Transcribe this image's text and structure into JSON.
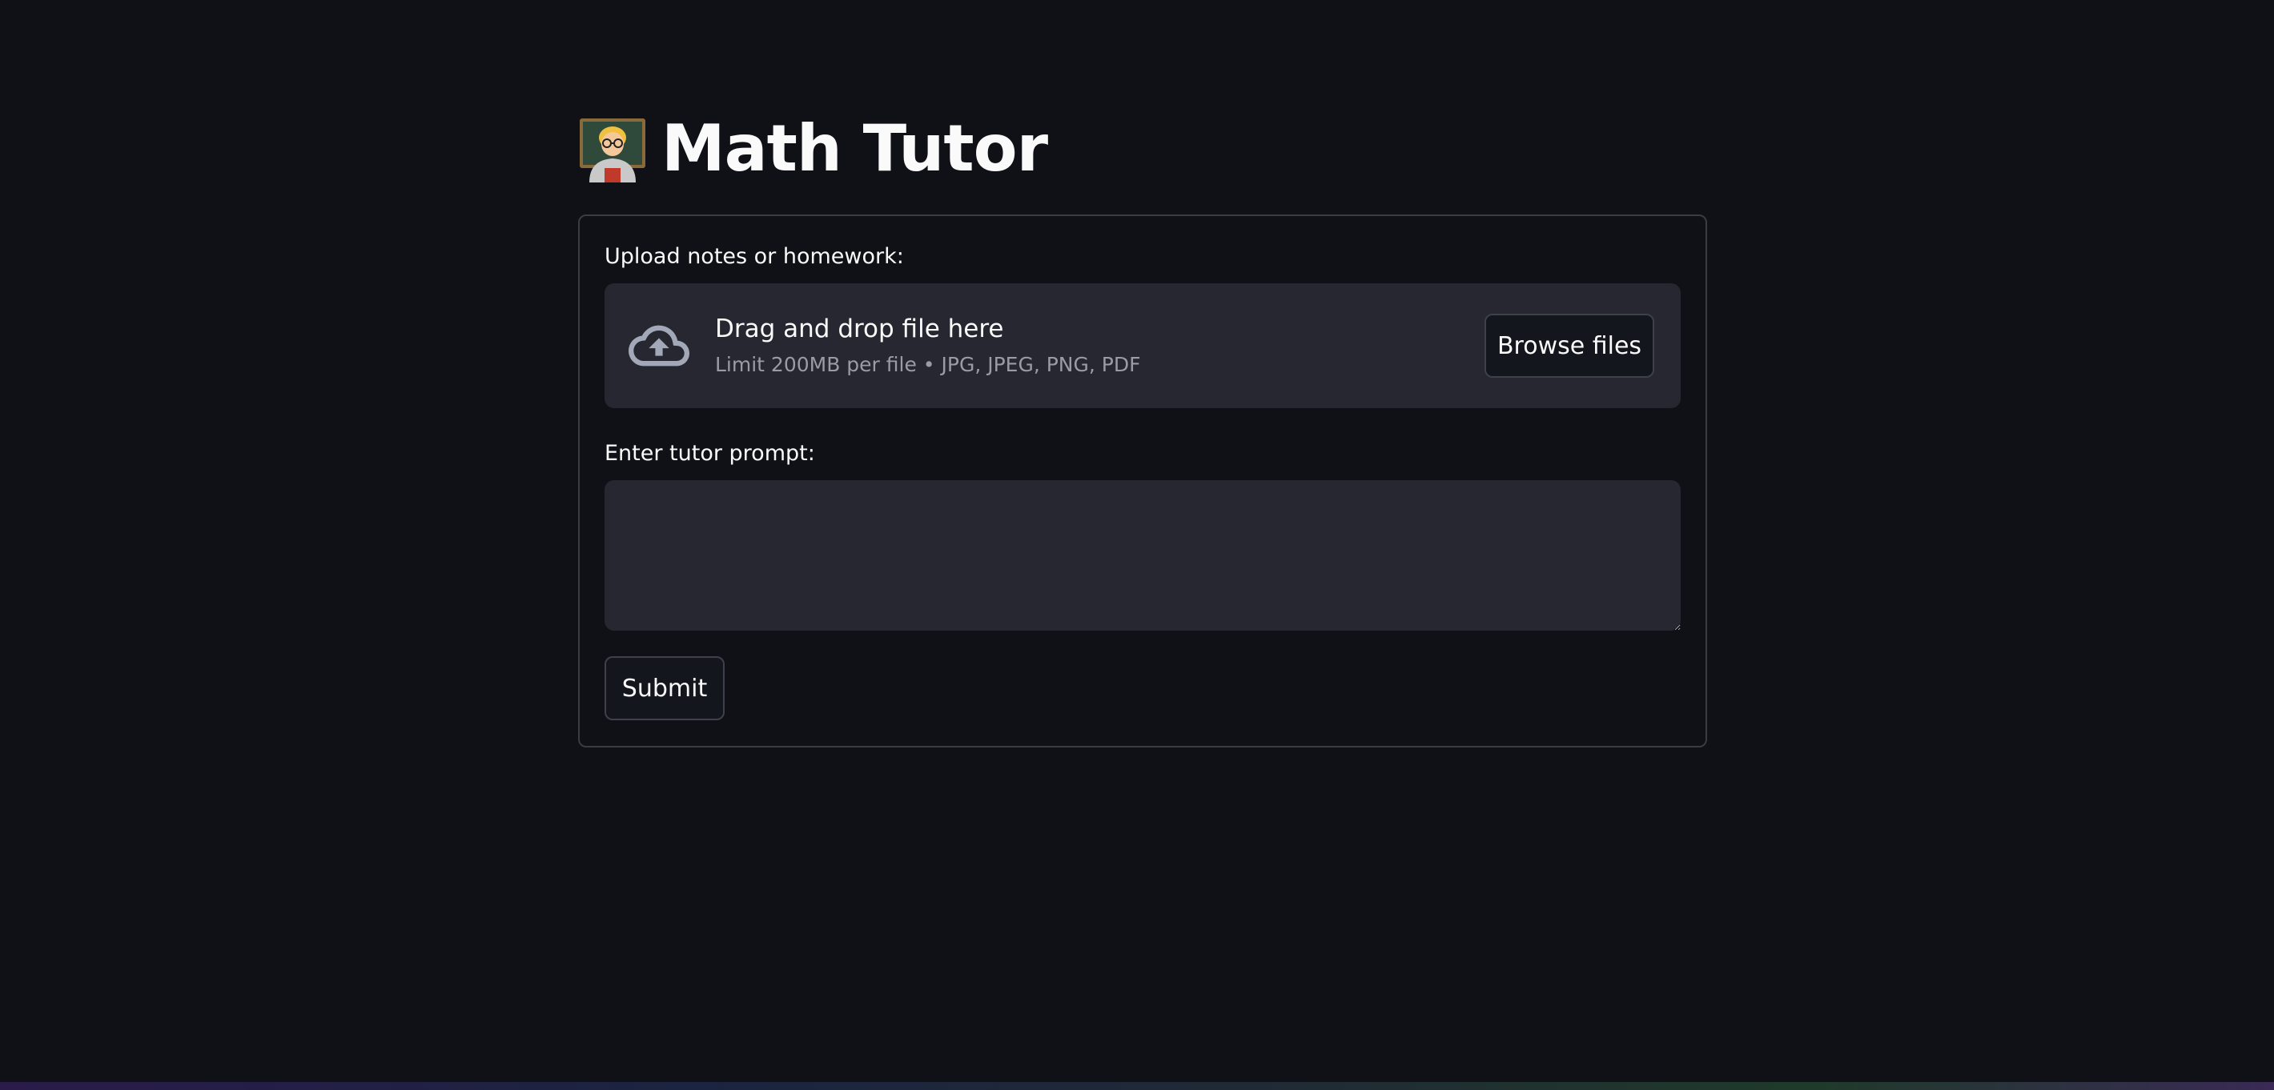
{
  "page": {
    "title": "Math Tutor",
    "title_icon": "teacher-emoji-icon"
  },
  "uploader": {
    "label": "Upload notes or homework:",
    "drop_title": "Drag and drop file here",
    "drop_subtitle": "Limit 200MB per file • JPG, JPEG, PNG, PDF",
    "browse_label": "Browse files",
    "icon": "cloud-upload-icon"
  },
  "prompt": {
    "label": "Enter tutor prompt:",
    "value": "",
    "placeholder": ""
  },
  "form": {
    "submit_label": "Submit"
  },
  "colors": {
    "background": "#0f1117",
    "panel": "#262730",
    "text": "#fafafa",
    "muted": "#9a9ca4",
    "border": "#3a3c44"
  }
}
